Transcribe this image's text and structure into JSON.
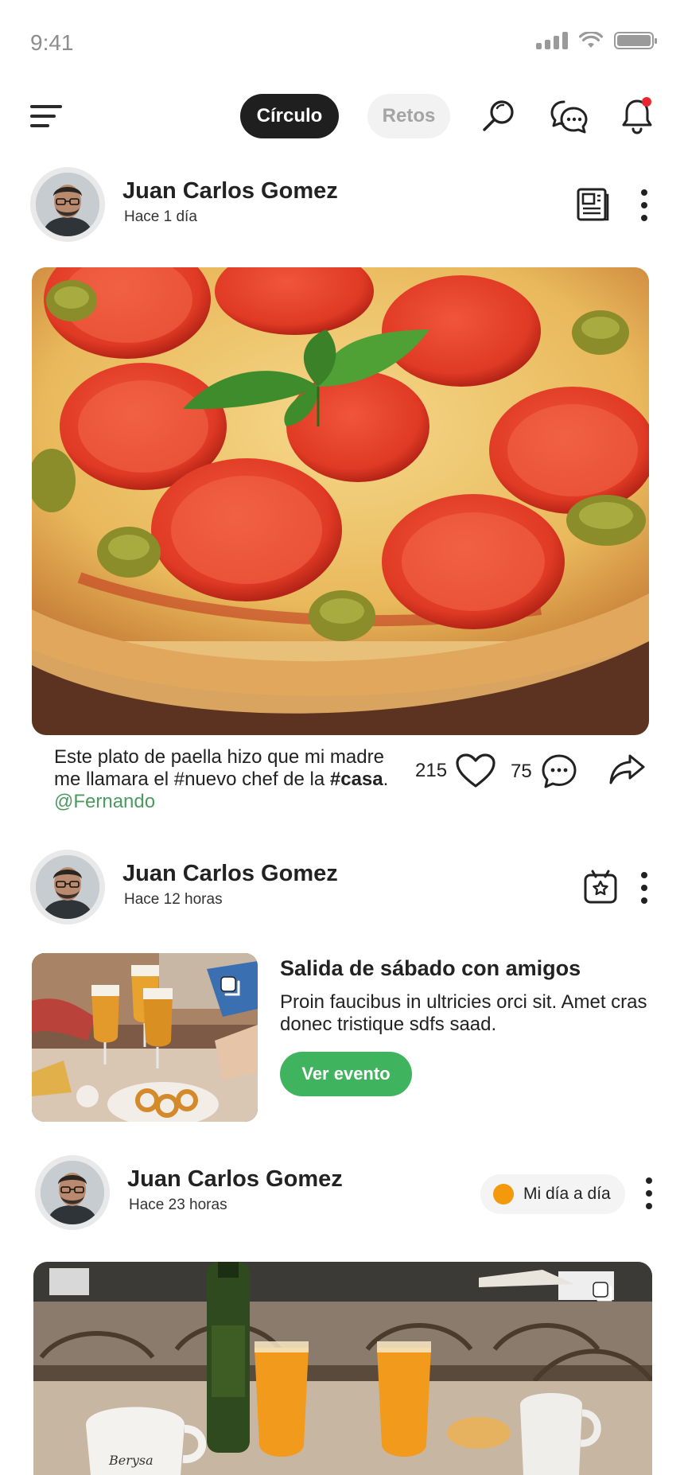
{
  "status_bar": {
    "time": "9:41"
  },
  "top_nav": {
    "tabs": [
      {
        "label": "Círculo",
        "active": true
      },
      {
        "label": "Retos",
        "active": false
      }
    ],
    "icons": [
      "search-icon",
      "chat-icon",
      "notification-bell-icon"
    ],
    "notification_dot_color": "#e8262b"
  },
  "posts": [
    {
      "author": "Juan Carlos Gomez",
      "time": "Hace 1 día",
      "type_icon": "news-icon",
      "caption_text": "Este plato de paella hizo que mi madre me llamara el #nuevo chef de la ",
      "caption_tag": "#casa",
      "caption_sep": ". ",
      "caption_mention": "@Fernando",
      "likes": "215",
      "comments": "75"
    },
    {
      "author": "Juan Carlos Gomez",
      "time": "Hace 12 horas",
      "type_icon": "event-calendar-icon",
      "event_title": "Salida de sábado con amigos",
      "event_description": "Proin faucibus in ultricies orci sit. Amet cras donec tristique sdfs saad.",
      "event_button": "Ver evento"
    },
    {
      "author": "Juan Carlos Gomez",
      "time": "Hace 23 horas",
      "chip_label": "Mi día a día",
      "chip_color": "#f39a0c"
    }
  ],
  "colors": {
    "accent_green": "#3fb35d",
    "mention_green": "#4c9a5f",
    "active_tab": "#1f1f1f",
    "inactive_tab_bg": "#f2f2f2"
  }
}
